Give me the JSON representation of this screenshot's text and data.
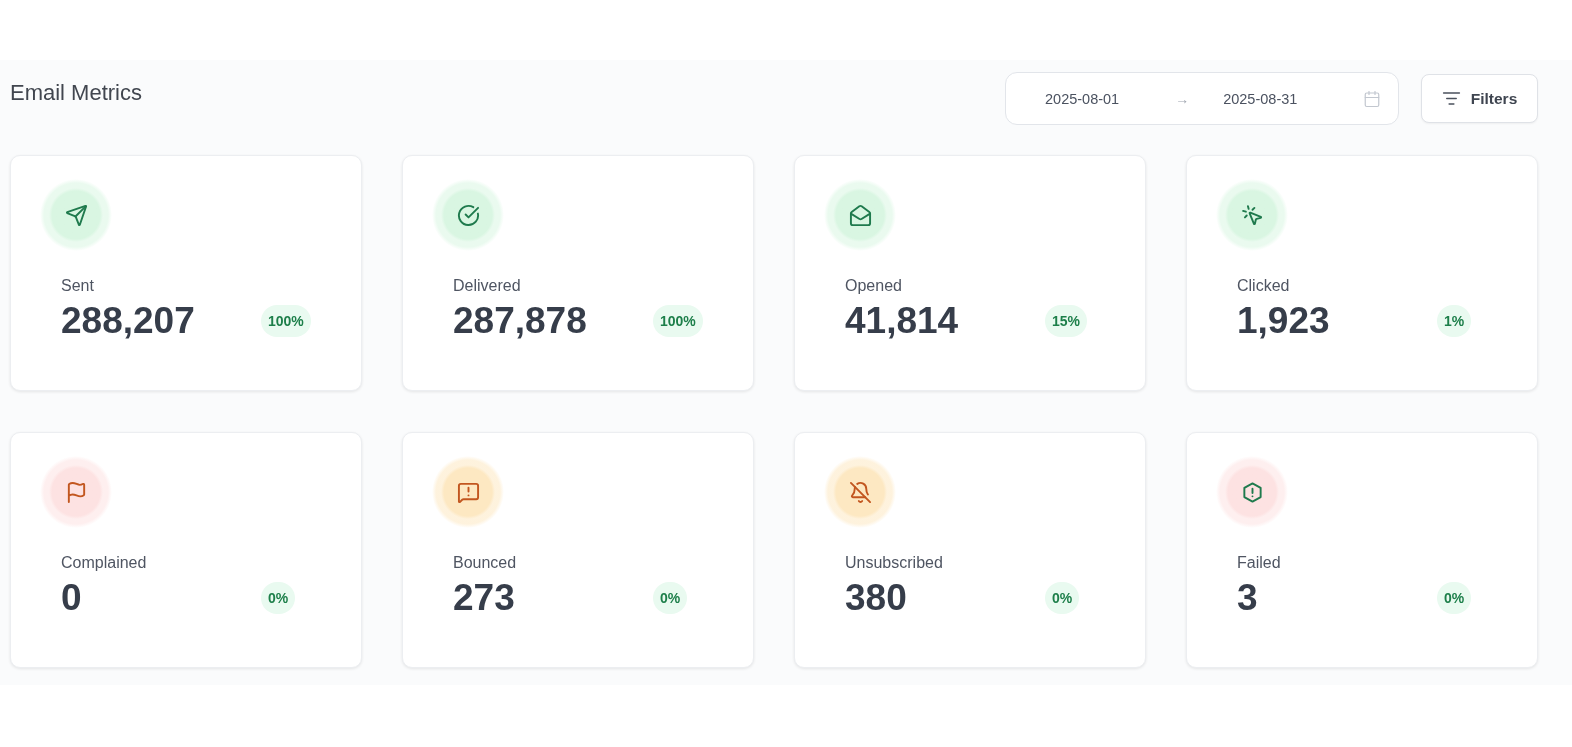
{
  "title": "Email Metrics",
  "date_range": {
    "start": "2025-08-01",
    "separator": "→",
    "end": "2025-08-31"
  },
  "filters_button": {
    "label": "Filters"
  },
  "metrics": [
    {
      "kind": "sent",
      "label": "Sent",
      "value": "288,207",
      "percent": "100%",
      "color": "#d9f6e2"
    },
    {
      "kind": "delivered",
      "label": "Delivered",
      "value": "287,878",
      "percent": "100%",
      "color": "#d9f6e2"
    },
    {
      "kind": "opened",
      "label": "Opened",
      "value": "41,814",
      "percent": "15%",
      "color": "#d9f6e2"
    },
    {
      "kind": "clicked",
      "label": "Clicked",
      "value": "1,923",
      "percent": "1%",
      "color": "#d9f6e2"
    },
    {
      "kind": "complained",
      "label": "Complained",
      "value": "0",
      "percent": "0%",
      "color": "#fde2e2"
    },
    {
      "kind": "bounced",
      "label": "Bounced",
      "value": "273",
      "percent": "0%",
      "color": "#fde8c2"
    },
    {
      "kind": "unsubscribed",
      "label": "Unsubscribed",
      "value": "380",
      "percent": "0%",
      "color": "#fde8c2"
    },
    {
      "kind": "failed",
      "label": "Failed",
      "value": "3",
      "percent": "0%",
      "color": "#fde2e2"
    }
  ]
}
